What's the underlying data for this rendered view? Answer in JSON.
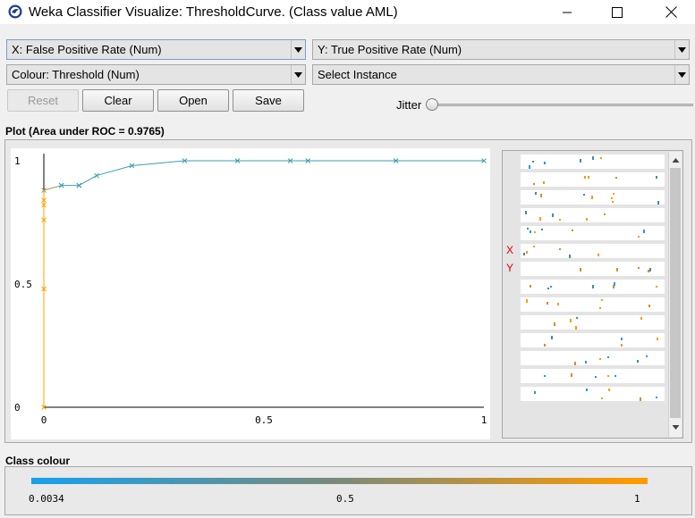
{
  "window": {
    "title": "Weka Classifier Visualize: ThresholdCurve. (Class value AML)"
  },
  "controls": {
    "x_axis": "X: False Positive Rate (Num)",
    "y_axis": "Y: True Positive Rate (Num)",
    "colour": "Colour: Threshold (Num)",
    "instance": "Select Instance",
    "reset": "Reset",
    "clear": "Clear",
    "open": "Open",
    "save": "Save",
    "jitter": "Jitter",
    "jitter_value": 0
  },
  "plot": {
    "title": "Plot (Area under ROC = 0.9765)",
    "x_tick_labels": [
      "0",
      "0.5",
      "1"
    ],
    "y_tick_labels": [
      "1",
      "0.5",
      "0"
    ]
  },
  "strips": {
    "x_label": "X",
    "y_label": "Y"
  },
  "class_colour": {
    "title": "Class colour",
    "min": "0.0034",
    "mid": "0.5",
    "max": "1",
    "low_color": "#1aa0e8",
    "high_color": "#ff9a00"
  },
  "chart_data": {
    "type": "line",
    "title": "",
    "xlabel": "False Positive Rate",
    "ylabel": "True Positive Rate",
    "xlim": [
      0,
      1
    ],
    "ylim": [
      0,
      1
    ],
    "series": [
      {
        "x": [
          0,
          0,
          0,
          0,
          0,
          0,
          0.04,
          0.04,
          0.08,
          0.08,
          0.12,
          0.2,
          0.32,
          0.44,
          0.56,
          0.6,
          0.8,
          1.0
        ],
        "y": [
          0,
          0.48,
          0.76,
          0.82,
          0.84,
          0.88,
          0.9,
          0.9,
          0.9,
          0.9,
          0.94,
          0.98,
          1.0,
          1.0,
          1.0,
          1.0,
          1.0,
          1.0
        ],
        "color_low": "#ffa000",
        "color_high": "#3a9fb0"
      }
    ]
  }
}
